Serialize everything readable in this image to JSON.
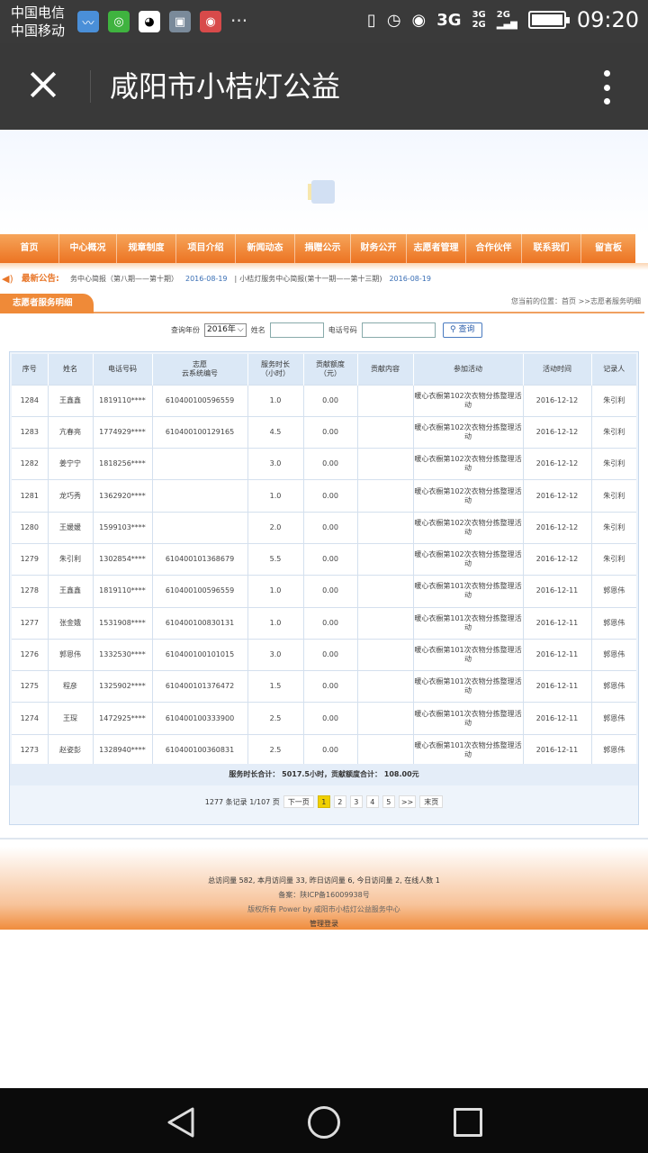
{
  "status_bar": {
    "carrier1": "中国电信",
    "carrier2": "中国移动",
    "dots": "···",
    "net_main": "3G",
    "net_3g": "3G",
    "net_2g_a": "2G",
    "net_2g_b": "2G",
    "time": "09:20"
  },
  "title_bar": {
    "title": "咸阳市小桔灯公益"
  },
  "nav": {
    "items": [
      "首页",
      "中心概况",
      "规章制度",
      "项目介绍",
      "新闻动态",
      "捐赠公示",
      "财务公开",
      "志愿者管理",
      "合作伙伴",
      "联系我们",
      "留言板"
    ]
  },
  "notice": {
    "label": "最新公告:",
    "item1": "务中心简报（第八期——第十期）",
    "date1": "2016-08-19",
    "item2": "小桔灯服务中心简报(第十一期——第十三期)",
    "date2": "2016-08-19"
  },
  "section": {
    "title": "志愿者服务明细",
    "breadcrumb": "您当前的位置：首页 >>志愿者服务明细"
  },
  "query": {
    "year_label": "查询年份",
    "year_value": "2016年",
    "name_label": "姓名",
    "phone_label": "电话号码",
    "search_button": "查询"
  },
  "table": {
    "headers": [
      "序号",
      "姓名",
      "电话号码",
      "志愿\n云系统编号",
      "服务时长\n（小时）",
      "贡献额度\n（元）",
      "贡献内容",
      "参加活动",
      "活动时间",
      "记录人"
    ],
    "rows": [
      [
        "1284",
        "王鑫鑫",
        "1819110****",
        "610400100596559",
        "1.0",
        "0.00",
        "",
        "暖心衣橱第102次衣物分拣整理活动",
        "2016-12-12",
        "朱引利"
      ],
      [
        "1283",
        "亢春亮",
        "1774929****",
        "610400100129165",
        "4.5",
        "0.00",
        "",
        "暖心衣橱第102次衣物分拣整理活动",
        "2016-12-12",
        "朱引利"
      ],
      [
        "1282",
        "姜宁宁",
        "1818256****",
        "",
        "3.0",
        "0.00",
        "",
        "暖心衣橱第102次衣物分拣整理活动",
        "2016-12-12",
        "朱引利"
      ],
      [
        "1281",
        "龙巧秀",
        "1362920****",
        "",
        "1.0",
        "0.00",
        "",
        "暖心衣橱第102次衣物分拣整理活动",
        "2016-12-12",
        "朱引利"
      ],
      [
        "1280",
        "王媛媛",
        "1599103****",
        "",
        "2.0",
        "0.00",
        "",
        "暖心衣橱第102次衣物分拣整理活动",
        "2016-12-12",
        "朱引利"
      ],
      [
        "1279",
        "朱引利",
        "1302854****",
        "610400101368679",
        "5.5",
        "0.00",
        "",
        "暖心衣橱第102次衣物分拣整理活动",
        "2016-12-12",
        "朱引利"
      ],
      [
        "1278",
        "王鑫鑫",
        "1819110****",
        "610400100596559",
        "1.0",
        "0.00",
        "",
        "暖心衣橱第101次衣物分拣整理活动",
        "2016-12-11",
        "郭恩伟"
      ],
      [
        "1277",
        "张金娥",
        "1531908****",
        "610400100830131",
        "1.0",
        "0.00",
        "",
        "暖心衣橱第101次衣物分拣整理活动",
        "2016-12-11",
        "郭恩伟"
      ],
      [
        "1276",
        "郭恩伟",
        "1332530****",
        "610400100101015",
        "3.0",
        "0.00",
        "",
        "暖心衣橱第101次衣物分拣整理活动",
        "2016-12-11",
        "郭恩伟"
      ],
      [
        "1275",
        "程彦",
        "1325902****",
        "610400101376472",
        "1.5",
        "0.00",
        "",
        "暖心衣橱第101次衣物分拣整理活动",
        "2016-12-11",
        "郭恩伟"
      ],
      [
        "1274",
        "王琛",
        "1472925****",
        "610400100333900",
        "2.5",
        "0.00",
        "",
        "暖心衣橱第101次衣物分拣整理活动",
        "2016-12-11",
        "郭恩伟"
      ],
      [
        "1273",
        "赵姿彭",
        "1328940****",
        "610400100360831",
        "2.5",
        "0.00",
        "",
        "暖心衣橱第101次衣物分拣整理活动",
        "2016-12-11",
        "郭恩伟"
      ]
    ],
    "totals": "服务时长合计： 5017.5小时，贡献额度合计： 108.00元"
  },
  "pager": {
    "summary": "1277 条记录 1/107 页",
    "next": "下一页",
    "pages": [
      "1",
      "2",
      "3",
      "4",
      "5"
    ],
    "more": ">>",
    "last": "末页"
  },
  "footer": {
    "stats": "总访问量 582, 本月访问量 33, 昨日访问量 6, 今日访问量 2, 在线人数 1",
    "icp": "备案：陕ICP备16009938号",
    "copyright": "版权所有 Power by 咸阳市小桔灯公益服务中心",
    "admin": "管理登录"
  },
  "colors": {
    "accent": "#ec7322",
    "title_bar": "#393939",
    "table_header": "#dbe8f6"
  }
}
